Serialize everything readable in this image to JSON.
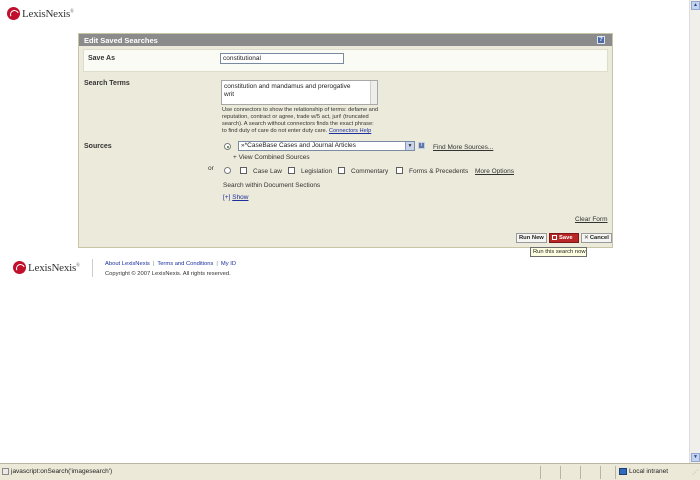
{
  "header": {
    "logo_text": "LexisNexis",
    "logo_reg": "®"
  },
  "panel": {
    "title": "Edit Saved Searches",
    "help_icon": "?",
    "save_as": {
      "label": "Save As",
      "value": "constitutional"
    },
    "search_terms": {
      "label": "Search Terms",
      "line1": "constitution and mandamus and prerogative",
      "line2": "writ",
      "help": [
        "Use connectors to show the relationship of terms: defame and",
        "reputation, contract or agree, trade w/5 act, juri! (truncated",
        "search). A search without connectors finds the exact phrase:",
        "to find duty of care do not enter duty care."
      ],
      "connectors_help": "Connectors Help"
    },
    "sources": {
      "label": "Sources",
      "selected": "»*CaseBase Cases and Journal Articles",
      "info_icon": "i",
      "find_more": "Find More Sources...",
      "view_combined": "+ View Combined Sources",
      "or": "or",
      "options": [
        "Case Law",
        "Legislation",
        "Commentary",
        "Forms & Precedents"
      ],
      "more_options": "More Options",
      "within_label": "Search within Document Sections",
      "show_prefix": "[+]",
      "show_link": "Show"
    },
    "clear_form": "Clear Form",
    "buttons": {
      "run_new": "Run New",
      "save": "Save",
      "cancel": "Cancel",
      "cancel_icon": "✕"
    },
    "tooltip": "Run this search now"
  },
  "footer": {
    "logo_text": "LexisNexis",
    "logo_reg": "®",
    "links": [
      "About LexisNexis",
      "Terms and Conditions",
      "My ID"
    ],
    "copyright": "Copyright © 2007 LexisNexis. All rights reserved."
  },
  "statusbar": {
    "text": "javascript:onSearch('imagesearch')",
    "zone": "Local intranet"
  },
  "colors": {
    "panel_bg": "#eceadb",
    "panel_header": "#8b8b8b",
    "link": "#1c2f9c",
    "brand_red": "#c0102c",
    "save_button": "#b82626"
  }
}
